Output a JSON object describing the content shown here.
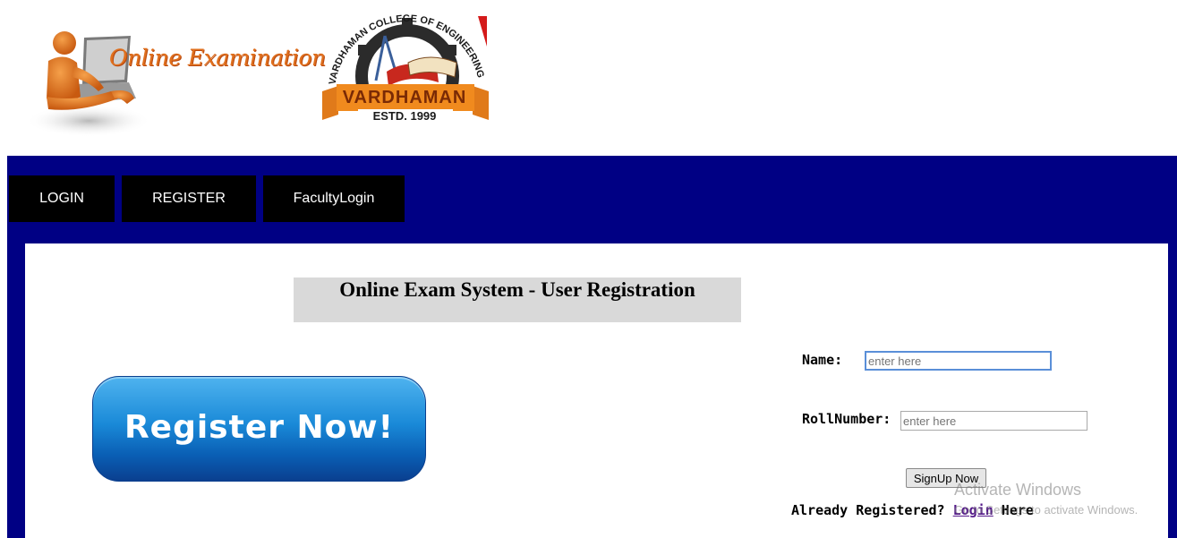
{
  "header": {
    "exam_logo_text": "Online Examination",
    "college_logo": {
      "arc_text": "VARDHAMAN COLLEGE OF ENGINEERING",
      "band_text": "VARDHAMAN",
      "estd_text": "ESTD. 1999"
    }
  },
  "nav": {
    "items": [
      {
        "label": "LOGIN"
      },
      {
        "label": "REGISTER"
      },
      {
        "label": "FacultyLogin"
      }
    ]
  },
  "main": {
    "title": "Online Exam System - User Registration",
    "register_button_label": "Register Now!",
    "form": {
      "name_label": "Name:",
      "name_placeholder": "enter here",
      "name_value": "",
      "roll_label": "RollNumber:",
      "roll_placeholder": "enter here",
      "roll_value": "",
      "signup_label": "SignUp Now",
      "already_prefix": "Already Registered? ",
      "login_link": "Login",
      "already_suffix": " Here"
    }
  },
  "watermark": {
    "line1": "Activate Windows",
    "line2": "Go to Settings to activate Windows."
  },
  "colors": {
    "nav_band": "#000084",
    "nav_item": "#000000",
    "title_box": "#d9d9d9",
    "register_button": "#1a8ad8",
    "link": "#551a8b"
  }
}
